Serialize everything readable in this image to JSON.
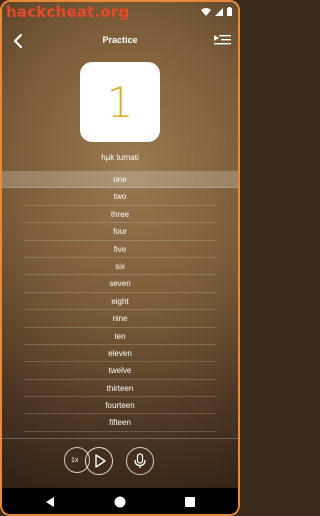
{
  "statusbar": {
    "watermark": "hackcheat.org",
    "icons": [
      "wifi-icon",
      "signal-icon",
      "battery-icon"
    ]
  },
  "appbar": {
    "title": "Practice",
    "back_icon": "chevron-left-icon",
    "list_icon": "playlist-icon"
  },
  "card": {
    "number": "1",
    "pronunciation": "hµk turnati"
  },
  "words": [
    {
      "label": "one",
      "active": true
    },
    {
      "label": "two"
    },
    {
      "label": "three"
    },
    {
      "label": "four"
    },
    {
      "label": "five"
    },
    {
      "label": "six"
    },
    {
      "label": "seven"
    },
    {
      "label": "eight"
    },
    {
      "label": "nine"
    },
    {
      "label": "ten"
    },
    {
      "label": "eleven"
    },
    {
      "label": "twelve"
    },
    {
      "label": "thirteen"
    },
    {
      "label": "fourteen"
    },
    {
      "label": "fifteen"
    }
  ],
  "controls": {
    "speed": "1x",
    "play_icon": "play-icon",
    "mic_icon": "mic-icon"
  },
  "colors": {
    "accent": "#e98a3a",
    "number": "#d8b227",
    "watermark": "#e84a2a"
  }
}
